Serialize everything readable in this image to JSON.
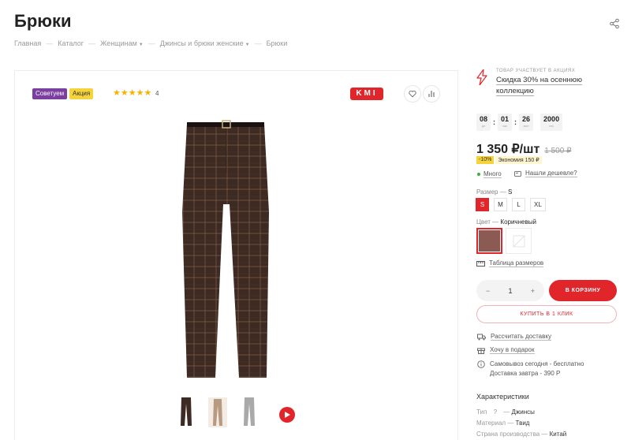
{
  "page": {
    "title": "Брюки"
  },
  "breadcrumbs": [
    "Главная",
    "Каталог",
    "Женщинам",
    "Джинсы и брюки женские",
    "Брюки"
  ],
  "breadcrumb_sep": "—",
  "gallery": {
    "badges": [
      "Советуем",
      "Акция"
    ],
    "stars": "★★★★★",
    "rating_count": "4",
    "brand": "KMI"
  },
  "promo": {
    "kicker": "ТОВАР УЧАСТВУЕТ В АКЦИЯХ",
    "link": "Скидка 30% на осеннюю коллекцию"
  },
  "timer": [
    {
      "value": "08",
      "label": "дн"
    },
    {
      "value": "01",
      "label": "час"
    },
    {
      "value": "26",
      "label": "мин"
    },
    {
      "value": "2000",
      "label": "сек"
    }
  ],
  "price": {
    "current": "1 350 ₽/шт",
    "old": "1 500 ₽",
    "discount_pct": "-10%",
    "savings": "Экономия 150 ₽"
  },
  "stock": {
    "status": "Много",
    "cheaper": "Нашли дешевле?"
  },
  "size": {
    "label": "Размер",
    "dash": "—",
    "selected": "S",
    "options": [
      "S",
      "M",
      "L",
      "XL"
    ]
  },
  "color": {
    "label": "Цвет",
    "dash": "—",
    "selected": "Коричневый",
    "swatch_color": "#8b5a52"
  },
  "size_table_link": "Таблица размеров",
  "cart": {
    "quantity": "1",
    "minus": "−",
    "plus": "+",
    "add_label": "В КОРЗИНУ",
    "one_click_label": "КУПИТЬ В 1 КЛИК"
  },
  "delivery": {
    "calc": "Рассчитать доставку",
    "gift": "Хочу в подарок",
    "pickup": "Самовывоз сегодня - бесплатно",
    "delivery": "Доставка завтра - 390 Р"
  },
  "characteristics": {
    "title": "Характеристики",
    "items": [
      {
        "name": "Тип",
        "hint": "?",
        "value": "Джинсы"
      },
      {
        "name": "Материал",
        "value": "Твид"
      },
      {
        "name": "Страна производства",
        "value": "Китай"
      }
    ]
  },
  "colors": {
    "accent": "#e0262b",
    "purple_badge": "#7b3fa0",
    "yellow_badge": "#f5d33a"
  }
}
